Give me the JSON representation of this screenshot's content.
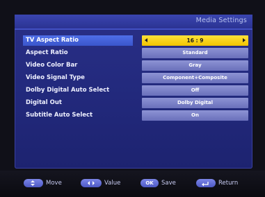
{
  "panel": {
    "title": "Media Settings"
  },
  "settings": [
    {
      "label": "TV Aspect Ratio",
      "value": "16 : 9"
    },
    {
      "label": "Aspect Ratio",
      "value": "Standard"
    },
    {
      "label": "Video Color Bar",
      "value": "Gray"
    },
    {
      "label": "Video Signal Type",
      "value": "Component+Composite"
    },
    {
      "label": "Dolby Digital Auto Select",
      "value": "Off"
    },
    {
      "label": "Digital Out",
      "value": "Dolby Digital"
    },
    {
      "label": "Subtitle Auto Select",
      "value": "On"
    }
  ],
  "selected_index": 0,
  "footer": {
    "move": {
      "key_icon": "up-down-arrows-icon",
      "label": "Move"
    },
    "value": {
      "key_icon": "left-right-arrows-icon",
      "label": "Value"
    },
    "save": {
      "key": "OK",
      "label": "Save"
    },
    "return": {
      "key_icon": "return-icon",
      "label": "Return"
    }
  },
  "colors": {
    "panel": "#232a7e",
    "selected_label": "#4f6fe8",
    "selected_value": "#ffe23a",
    "value_box": "#7c82c8"
  }
}
